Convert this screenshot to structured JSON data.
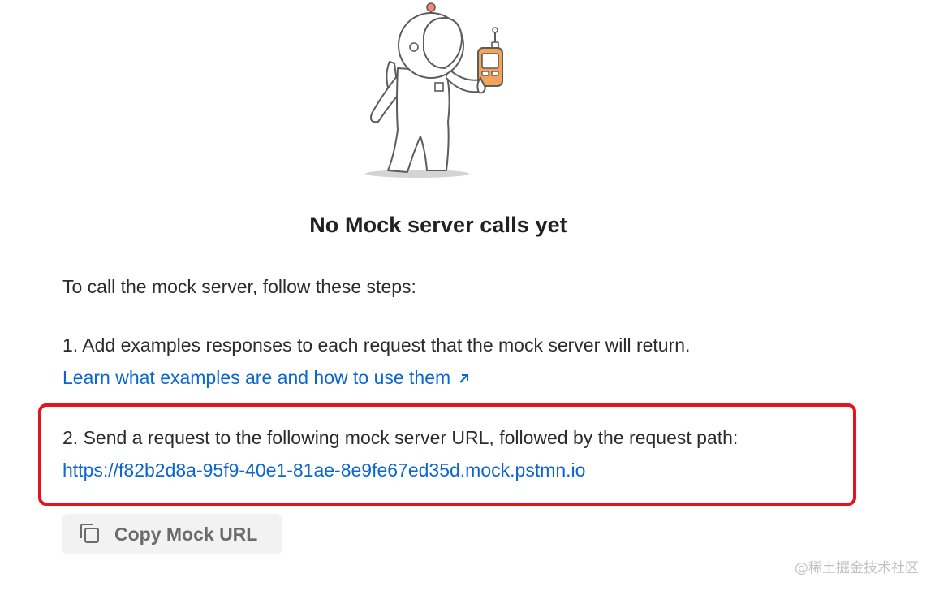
{
  "empty_state": {
    "title": "No Mock server calls yet",
    "intro": "To call the mock server, follow these steps:",
    "step1": "1. Add examples responses to each request that the mock server will return.",
    "learn_link": "Learn what examples are and how to use them",
    "step2": "2. Send a request to the following mock server URL, followed by the request path:",
    "mock_url": "https://f82b2d8a-95f9-40e1-81ae-8e9fe67ed35d.mock.pstmn.io",
    "copy_button_label": "Copy Mock URL"
  },
  "icons": {
    "external_link": "external-arrow-icon",
    "copy": "copy-icon",
    "illustration": "astronaut-with-walkie-talkie"
  },
  "colors": {
    "link": "#0b66d0",
    "highlight": "#e5131d",
    "accent": "#f4a35a"
  },
  "watermark": "@稀土掘金技术社区"
}
